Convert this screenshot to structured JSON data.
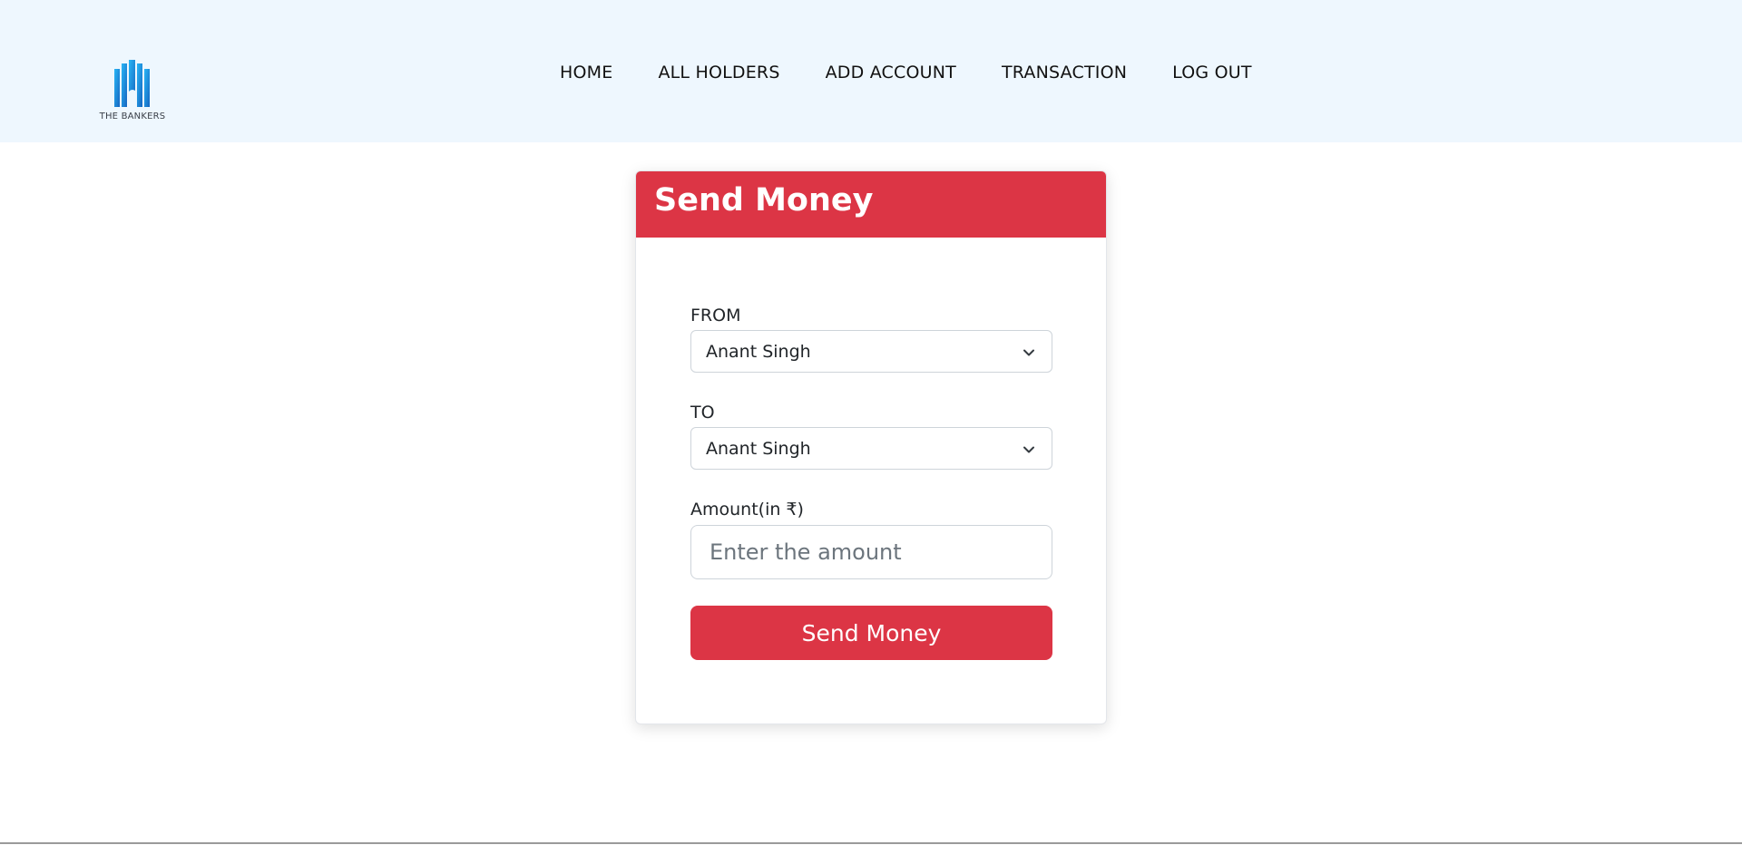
{
  "header": {
    "logo_text": "THE BANKERS",
    "logo_icon": "building-icon",
    "nav": [
      {
        "label": "HOME"
      },
      {
        "label": "ALL HOLDERS"
      },
      {
        "label": "ADD ACCOUNT"
      },
      {
        "label": "TRANSACTION"
      },
      {
        "label": "LOG OUT"
      }
    ]
  },
  "form": {
    "title": "Send Money",
    "from": {
      "label": "FROM",
      "value": "Anant Singh"
    },
    "to": {
      "label": "TO",
      "value": "Anant Singh"
    },
    "amount": {
      "label": "Amount(in ₹)",
      "placeholder": "Enter the amount",
      "value": ""
    },
    "submit_label": "Send Money"
  },
  "colors": {
    "header_bg": "#eef7fe",
    "accent": "#dc3545",
    "logo_blue": "#1e88d6"
  }
}
